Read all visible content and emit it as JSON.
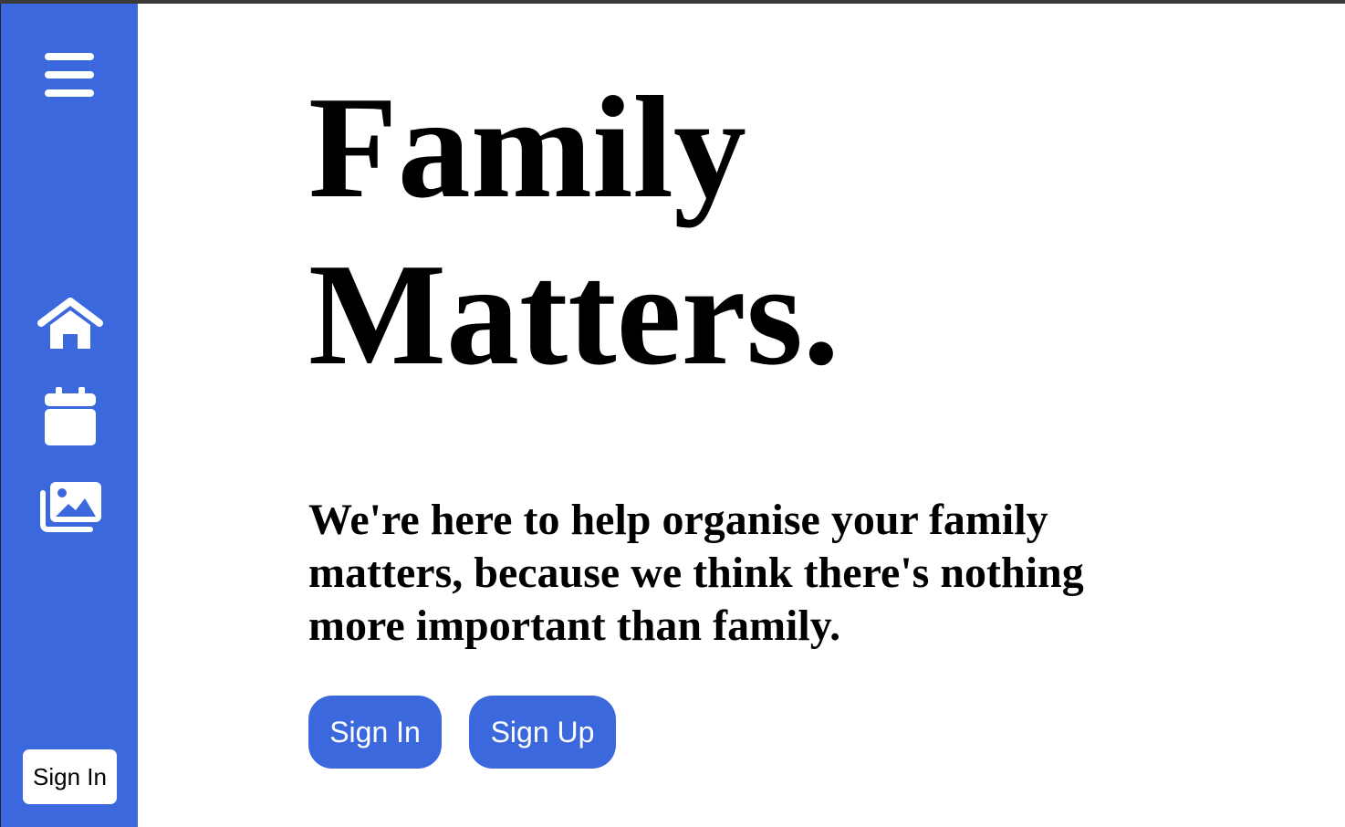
{
  "sidebar": {
    "icons": [
      "menu-icon",
      "home-icon",
      "calendar-icon",
      "gallery-icon"
    ],
    "signin_label": "Sign In"
  },
  "hero": {
    "title_line1": "Family",
    "title_line2": "Matters.",
    "tagline": "We're here to help organise your family matters, because we think there's nothing more important than family."
  },
  "buttons": {
    "signin_label": "Sign In",
    "signup_label": "Sign Up"
  },
  "colors": {
    "accent": "#3b68dc",
    "text": "#000000",
    "background": "#ffffff"
  }
}
